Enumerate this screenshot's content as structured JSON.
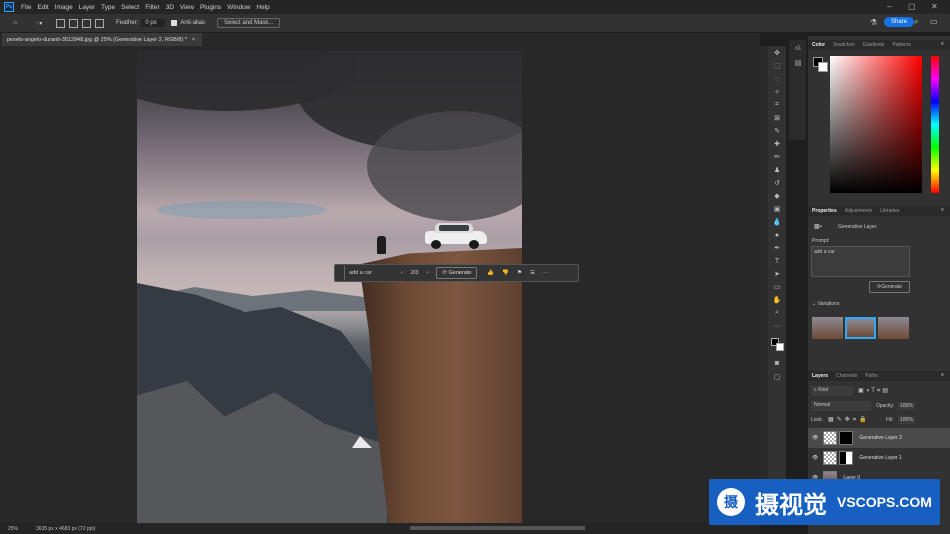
{
  "app": {
    "logo": "Ps"
  },
  "menubar": {
    "items": [
      "File",
      "Edit",
      "Image",
      "Layer",
      "Type",
      "Select",
      "Filter",
      "3D",
      "View",
      "Plugins",
      "Window",
      "Help"
    ]
  },
  "options": {
    "feather_label": "Feather:",
    "feather_value": "0 px",
    "antialias_label": "Anti-alias",
    "select_mask_label": "Select and Mask...",
    "share_label": "Share"
  },
  "document": {
    "tab_title": "pexels-angelo-duranti-3512848.jpg @ 25% (Generative Layer 2, RGB/8) *",
    "close": "×"
  },
  "genbar": {
    "prompt": "add a car",
    "counter": "2/3",
    "generate_label": "Generate",
    "more": "···"
  },
  "status": {
    "zoom": "25%",
    "doc_info": "3635 px x 4683 px (72 ppi)"
  },
  "color_panel": {
    "tabs": [
      "Color",
      "Swatches",
      "Gradients",
      "Patterns"
    ],
    "active": "Color",
    "field_hue": "#ff0000"
  },
  "properties": {
    "tabs": [
      "Properties",
      "Adjustments",
      "Libraries"
    ],
    "active": "Properties",
    "layer_type": "Generative Layer",
    "prompt_label": "Prompt:",
    "prompt_value": "add a car",
    "generate_label": "Generate",
    "variations_label": "Variations"
  },
  "layers": {
    "tabs": [
      "Layers",
      "Channels",
      "Paths"
    ],
    "active": "Layers",
    "kind_label": "Kind",
    "blend_mode": "Normal",
    "opacity_label": "Opacity:",
    "opacity_value": "100%",
    "lock_label": "Lock:",
    "fill_label": "Fill:",
    "fill_value": "100%",
    "rows": [
      {
        "name": "Generative Layer 2",
        "selected": true
      },
      {
        "name": "Generative Layer 1",
        "selected": false
      },
      {
        "name": "Layer 0",
        "selected": false
      }
    ]
  },
  "watermark": {
    "text": "摄视觉",
    "site": "VSCOPS.COM"
  },
  "colors": {
    "accent": "#31a8ff",
    "share": "#1473e6",
    "watermark": "#1760c2"
  }
}
